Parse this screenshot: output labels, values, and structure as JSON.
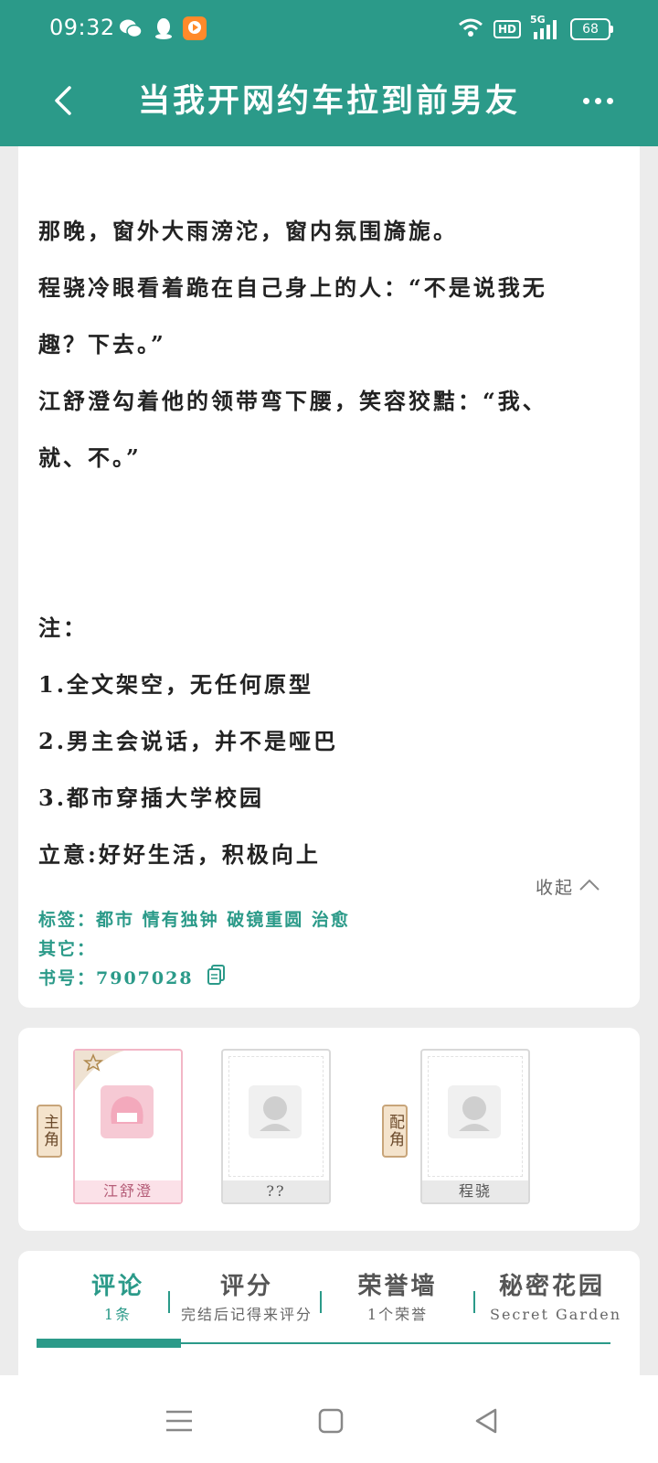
{
  "status_bar": {
    "time": "09:32",
    "hd": "HD",
    "network": "5G",
    "battery": "68",
    "icons": [
      "wechat-icon",
      "qq-icon",
      "video-app-icon",
      "wifi-icon",
      "signal-icon",
      "battery-icon"
    ]
  },
  "nav": {
    "title": "当我开网约车拉到前男友",
    "back_icon": "back-arrow-icon",
    "more_icon": "more-dots-icon"
  },
  "intro": {
    "lines": [
      "那晚，窗外大雨滂沱，窗内氛围旖旎。",
      "程骁冷眼看着跪在自己身上的人：“不是说我无",
      "趣？下去。”",
      "江舒澄勾着他的领带弯下腰，笑容狡黠：“我、",
      "就、不。”",
      "",
      "",
      "注：",
      "1.全文架空，无任何原型",
      "2.男主会说话，并不是哑巴",
      "3.都市穿插大学校园",
      "立意:好好生活，积极向上"
    ],
    "collapse_label": "收起",
    "tags_label": "标签：都市 情有独钟 破镜重圆 治愈",
    "other_label": "其它：",
    "book_id_label": "书号：7907028"
  },
  "characters": {
    "main_tag": "主角",
    "support_tag": "配角",
    "items": [
      {
        "name": "江舒澄",
        "role": "main"
      },
      {
        "name": "??",
        "role": "main"
      },
      {
        "name": "程骁",
        "role": "support"
      }
    ]
  },
  "tabs": [
    {
      "title": "评论",
      "sub": "1条",
      "active": true
    },
    {
      "title": "评分",
      "sub": "完结后记得来评分",
      "active": false
    },
    {
      "title": "荣誉墙",
      "sub": "1个荣誉",
      "active": false
    },
    {
      "title": "秘密花园",
      "sub": "Secret Garden",
      "active": false
    }
  ],
  "colors": {
    "accent": "#2b9a89",
    "background": "#ececec",
    "main_card_pink": "#f2b6c6"
  },
  "system_nav": [
    "menu-icon",
    "home-icon",
    "back-triangle-icon"
  ]
}
